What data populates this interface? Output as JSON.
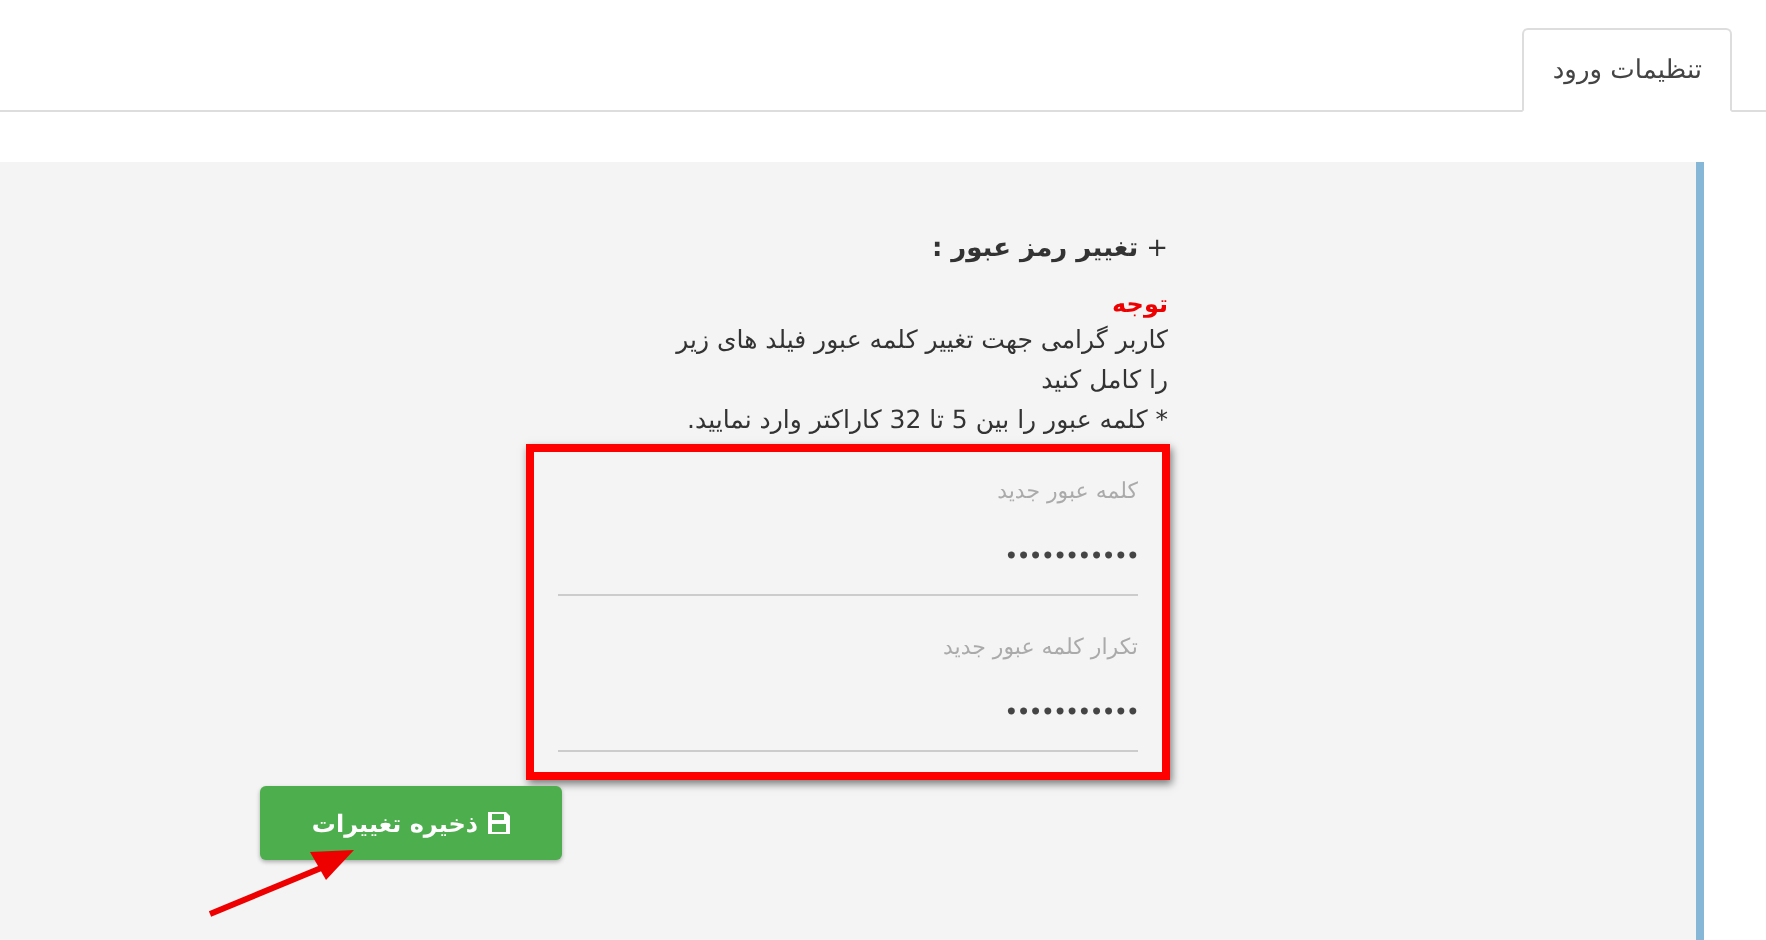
{
  "tabs": [
    {
      "label": "تنظیمات ورود",
      "selected": true
    }
  ],
  "section": {
    "toggle": "+",
    "title": "تغییر رمز عبور :"
  },
  "notice": {
    "heading": "توجه",
    "message": "کاربر گرامی جهت تغییر کلمه عبور فیلد های زیر را کامل کنید",
    "rule": "* کلمه عبور را بین 5 تا 32 کاراکتر وارد نمایید."
  },
  "fields": [
    {
      "label": "کلمه عبور جدید",
      "value": "•••••••••••"
    },
    {
      "label": "تکرار کلمه عبور جدید",
      "value": "•••••••••••"
    }
  ],
  "save_button": {
    "label": "ذخیره تغییرات"
  }
}
